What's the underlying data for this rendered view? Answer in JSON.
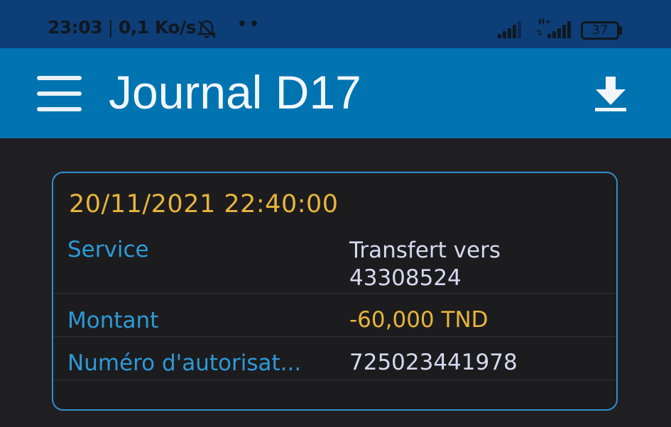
{
  "status_bar": {
    "time": "23:03",
    "speed": "0,1 Ko/s",
    "network_label": "H+",
    "battery": "37"
  },
  "app_bar": {
    "title": "Journal D17"
  },
  "transaction": {
    "datetime": "20/11/2021 22:40:00",
    "rows": [
      {
        "label": "Service",
        "value_line1": "Transfert vers",
        "value_line2": "43308524"
      },
      {
        "label": "Montant",
        "value": "-60,000 TND"
      },
      {
        "label": "Numéro d'autorisat...",
        "value": "725023441978"
      }
    ]
  },
  "colors": {
    "status_bar_bg": "#0e3e77",
    "app_bar_bg": "#0073b1",
    "background": "#1f1f21",
    "date_color": "#e7b43d",
    "label_color": "#2d9ad9",
    "value_color": "#d6d8ef",
    "amount_color": "#e7b43d",
    "card_border": "#2f8fd0"
  },
  "icons": {
    "menu": "hamburger-menu-icon",
    "download": "download-icon",
    "notifications_off": "bell-off-icon",
    "signal": "signal-icon",
    "battery": "battery-icon"
  }
}
